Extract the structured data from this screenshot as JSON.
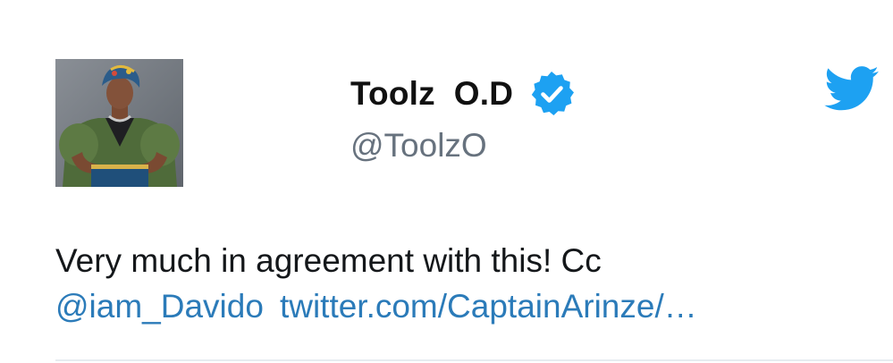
{
  "user": {
    "display_name": "Toolz  O.D",
    "handle": "@ToolzO",
    "verified_icon": "verified-badge-icon"
  },
  "tweet": {
    "text": "Very much in agreement with this! Cc",
    "mention": "@iam_Davido",
    "link_text": "twitter.com/CaptainArinze/…"
  },
  "icons": {
    "brand": "twitter-bird-icon"
  },
  "colors": {
    "link": "#2b7bb9",
    "verified_blue": "#1da1f2",
    "twitter_blue": "#1da1f2",
    "handle_gray": "#67727e",
    "text": "#14171a"
  }
}
